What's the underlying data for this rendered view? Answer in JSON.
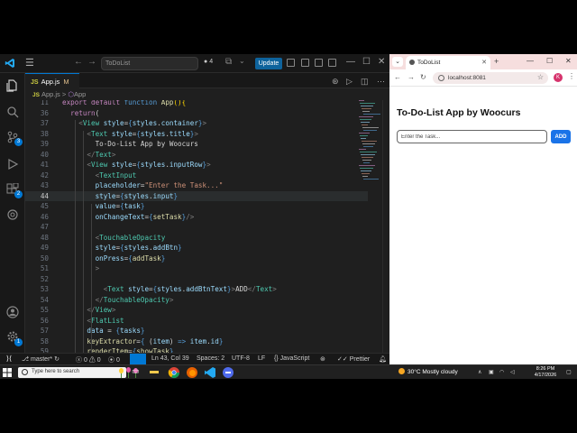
{
  "vscode": {
    "title_search": "ToDoList",
    "badge_count": "4",
    "update_label": "Update",
    "tab": {
      "type": "JS",
      "name": "App.js",
      "modified": "M"
    },
    "breadcrumb": {
      "type": "JS",
      "file": "App.js",
      "separator": ">",
      "symbol_icon": "cube-icon",
      "symbol": "App"
    },
    "activity_badges": {
      "source_control": "3",
      "extensions": "2",
      "accounts": "1"
    },
    "code_lines": [
      {
        "n": "11",
        "parts": [
          [
            "kw",
            "export "
          ],
          [
            "kw",
            "default "
          ],
          [
            "kw2",
            "function "
          ],
          [
            "fn",
            "App"
          ],
          [
            "curly",
            "(){"
          ]
        ]
      },
      {
        "n": "36",
        "parts": [
          [
            "kw",
            "  return"
          ],
          [
            "txt",
            "("
          ]
        ]
      },
      {
        "n": "37",
        "parts": [
          [
            "brk",
            "    <"
          ],
          [
            "tag",
            "View "
          ],
          [
            "attr",
            "style"
          ],
          [
            "txt",
            "="
          ],
          [
            "kw2",
            "{"
          ],
          [
            "attr",
            "styles"
          ],
          [
            "txt",
            "."
          ],
          [
            "attr",
            "container"
          ],
          [
            "kw2",
            "}"
          ],
          [
            "brk",
            ">"
          ]
        ]
      },
      {
        "n": "38",
        "parts": [
          [
            "brk",
            "      <"
          ],
          [
            "tag",
            "Text "
          ],
          [
            "attr",
            "style"
          ],
          [
            "txt",
            "="
          ],
          [
            "kw2",
            "{"
          ],
          [
            "attr",
            "styles"
          ],
          [
            "txt",
            "."
          ],
          [
            "attr",
            "title"
          ],
          [
            "kw2",
            "}"
          ],
          [
            "brk",
            ">"
          ]
        ]
      },
      {
        "n": "39",
        "parts": [
          [
            "txt",
            "        To-Do-List App by Woocurs"
          ]
        ]
      },
      {
        "n": "40",
        "parts": [
          [
            "brk",
            "      </"
          ],
          [
            "tag",
            "Text"
          ],
          [
            "brk",
            ">"
          ]
        ]
      },
      {
        "n": "41",
        "parts": [
          [
            "brk",
            "      <"
          ],
          [
            "tag",
            "View "
          ],
          [
            "attr",
            "style"
          ],
          [
            "txt",
            "="
          ],
          [
            "kw2",
            "{"
          ],
          [
            "attr",
            "styles"
          ],
          [
            "txt",
            "."
          ],
          [
            "attr",
            "inputRow"
          ],
          [
            "kw2",
            "}"
          ],
          [
            "brk",
            ">"
          ]
        ]
      },
      {
        "n": "42",
        "parts": [
          [
            "brk",
            "        <"
          ],
          [
            "tag",
            "TextInput"
          ]
        ]
      },
      {
        "n": "43",
        "parts": [
          [
            "attr",
            "        placeholder"
          ],
          [
            "txt",
            "="
          ],
          [
            "str",
            "\"Enter the Task...\""
          ]
        ]
      },
      {
        "n": "44",
        "parts": [
          [
            "attr",
            "        style"
          ],
          [
            "txt",
            "="
          ],
          [
            "kw2",
            "{"
          ],
          [
            "attr",
            "styles"
          ],
          [
            "txt",
            "."
          ],
          [
            "attr",
            "input"
          ],
          [
            "kw2",
            "}"
          ]
        ]
      },
      {
        "n": "45",
        "parts": [
          [
            "attr",
            "        value"
          ],
          [
            "txt",
            "="
          ],
          [
            "kw2",
            "{"
          ],
          [
            "attr",
            "task"
          ],
          [
            "kw2",
            "}"
          ]
        ]
      },
      {
        "n": "46",
        "parts": [
          [
            "attr",
            "        onChangeText"
          ],
          [
            "txt",
            "="
          ],
          [
            "kw2",
            "{"
          ],
          [
            "fn",
            "setTask"
          ],
          [
            "kw2",
            "}"
          ],
          [
            "brk",
            "/>"
          ]
        ]
      },
      {
        "n": "47",
        "parts": []
      },
      {
        "n": "48",
        "parts": [
          [
            "brk",
            "        <"
          ],
          [
            "tag",
            "TouchableOpacity"
          ]
        ]
      },
      {
        "n": "49",
        "parts": [
          [
            "attr",
            "        style"
          ],
          [
            "txt",
            "="
          ],
          [
            "kw2",
            "{"
          ],
          [
            "attr",
            "styles"
          ],
          [
            "txt",
            "."
          ],
          [
            "attr",
            "addBtn"
          ],
          [
            "kw2",
            "}"
          ]
        ]
      },
      {
        "n": "50",
        "parts": [
          [
            "attr",
            "        onPress"
          ],
          [
            "txt",
            "="
          ],
          [
            "kw2",
            "{"
          ],
          [
            "fn",
            "addTask"
          ],
          [
            "kw2",
            "}"
          ]
        ]
      },
      {
        "n": "51",
        "parts": [
          [
            "brk",
            "        >"
          ]
        ]
      },
      {
        "n": "52",
        "parts": []
      },
      {
        "n": "53",
        "parts": [
          [
            "brk",
            "          <"
          ],
          [
            "tag",
            "Text "
          ],
          [
            "attr",
            "style"
          ],
          [
            "txt",
            "="
          ],
          [
            "kw2",
            "{"
          ],
          [
            "attr",
            "styles"
          ],
          [
            "txt",
            "."
          ],
          [
            "attr",
            "addBtnText"
          ],
          [
            "kw2",
            "}"
          ],
          [
            "brk",
            ">"
          ],
          [
            "txt",
            "ADD"
          ],
          [
            "brk",
            "</"
          ],
          [
            "tag",
            "Text"
          ],
          [
            "brk",
            ">"
          ]
        ]
      },
      {
        "n": "54",
        "parts": [
          [
            "brk",
            "        </"
          ],
          [
            "tag",
            "TouchableOpacity"
          ],
          [
            "brk",
            ">"
          ]
        ]
      },
      {
        "n": "55",
        "parts": [
          [
            "brk",
            "      </"
          ],
          [
            "tag",
            "View"
          ],
          [
            "brk",
            ">"
          ]
        ]
      },
      {
        "n": "56",
        "parts": [
          [
            "brk",
            "      <"
          ],
          [
            "tag",
            "FlatList"
          ]
        ]
      },
      {
        "n": "57",
        "parts": [
          [
            "attr",
            "      data "
          ],
          [
            "txt",
            "= "
          ],
          [
            "kw2",
            "{"
          ],
          [
            "attr",
            "tasks"
          ],
          [
            "kw2",
            "}"
          ]
        ]
      },
      {
        "n": "58",
        "parts": [
          [
            "fn",
            "      keyExtractor"
          ],
          [
            "txt",
            "="
          ],
          [
            "kw2",
            "{ "
          ],
          [
            "txt",
            "("
          ],
          [
            "attr",
            "item"
          ],
          [
            "txt",
            ") "
          ],
          [
            "kw2",
            "=> "
          ],
          [
            "attr",
            "item"
          ],
          [
            "txt",
            "."
          ],
          [
            "attr",
            "id"
          ],
          [
            "kw2",
            "}"
          ]
        ]
      },
      {
        "n": "59",
        "parts": [
          [
            "fn",
            "      renderItem"
          ],
          [
            "txt",
            "="
          ],
          [
            "kw2",
            "{"
          ],
          [
            "fn",
            "showTask"
          ],
          [
            "kw2",
            "}"
          ]
        ]
      }
    ],
    "status": {
      "branch": "master*",
      "errors": "0",
      "warnings": "0",
      "ports": "0",
      "position": "Ln 43, Col 39",
      "spaces": "Spaces: 2",
      "encoding": "UTF-8",
      "eol": "LF",
      "language": "JavaScript",
      "formatter": "Prettier"
    }
  },
  "chrome": {
    "tab_title": "ToDoList",
    "url": "localhost:8081",
    "profile_initial": "K",
    "page": {
      "title": "To-Do-List App by Woocurs",
      "input_placeholder": "Enter the Task...",
      "add_label": "ADD"
    },
    "accent": "#1a73e8"
  },
  "taskbar": {
    "search_placeholder": "Type here to search",
    "weather": "30°C  Mostly cloudy",
    "time": "8:26 PM",
    "date": "4/17/2026"
  }
}
